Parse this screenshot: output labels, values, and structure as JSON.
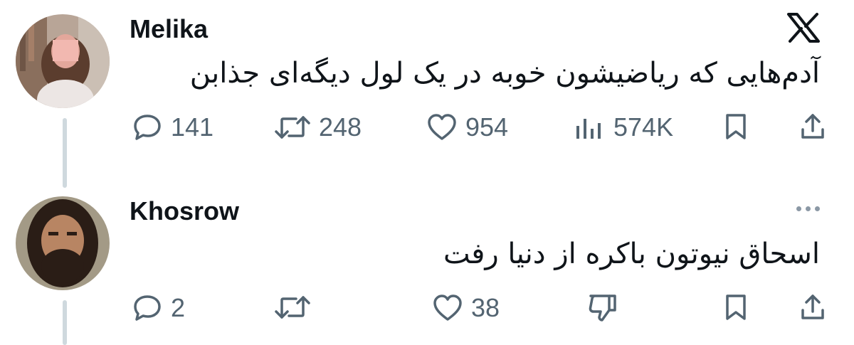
{
  "brand_icon": "x-logo-icon",
  "colors": {
    "text": "#0f1419",
    "muted": "#536471",
    "thread_line": "#cfd9de"
  },
  "tweet": {
    "author": "Melika",
    "text": "آدم‌هایی که ریاضیشون خوبه در یک لول دیگه‌ای جذابن",
    "replies": "141",
    "reposts": "248",
    "likes": "954",
    "views": "574K"
  },
  "reply": {
    "author": "Khosrow",
    "text": "اسحاق نیوتون باکره از دنیا رفت",
    "replies": "2",
    "likes": "38"
  }
}
